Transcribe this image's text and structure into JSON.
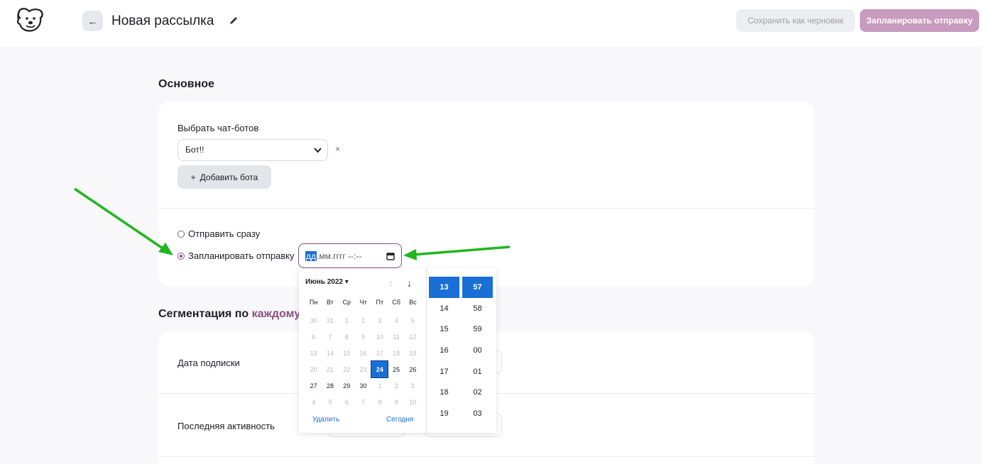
{
  "header": {
    "title": "Новая рассылка",
    "draft_label": "Сохранить как черновик",
    "schedule_label": "Запланировать отправку"
  },
  "basic": {
    "section_title": "Основное",
    "bots_label": "Выбрать чат-ботов",
    "bot_selected": "Бот!!",
    "clear_symbol": "×",
    "add_bot_plus": "+",
    "add_bot_label": "Добавить бота",
    "send_now_label": "Отправить сразу",
    "schedule_label": "Запланировать отправку",
    "datetime_day_placeholder": "дд",
    "datetime_rest_placeholder": ".мм.гггг --:--"
  },
  "segmentation": {
    "title_prefix": "Сегментация по ",
    "title_highlight": "каждому",
    "rows": [
      {
        "label": "Дата подписки"
      },
      {
        "label": "Последняя активность"
      }
    ]
  },
  "picker": {
    "month_label": "Июнь 2022 ▾",
    "up_arrow": "↑",
    "down_arrow": "↓",
    "weekdays": [
      "Пн",
      "Вт",
      "Ср",
      "Чт",
      "Пт",
      "Сб",
      "Вс"
    ],
    "days": [
      [
        "30",
        "31",
        "1",
        "2",
        "3",
        "4",
        "5"
      ],
      [
        "6",
        "7",
        "8",
        "9",
        "10",
        "11",
        "12"
      ],
      [
        "13",
        "14",
        "15",
        "16",
        "17",
        "18",
        "19"
      ],
      [
        "20",
        "21",
        "22",
        "23",
        "24",
        "25",
        "26"
      ],
      [
        "27",
        "28",
        "29",
        "30",
        "1",
        "2",
        "3"
      ],
      [
        "4",
        "5",
        "6",
        "7",
        "8",
        "9",
        "10"
      ]
    ],
    "selected_day": "24",
    "clear_label": "Удалить",
    "today_label": "Сегодня",
    "hours": [
      "13",
      "14",
      "15",
      "16",
      "17",
      "18",
      "19"
    ],
    "minutes": [
      "57",
      "58",
      "59",
      "00",
      "01",
      "02",
      "03"
    ],
    "selected_hour": "13",
    "selected_minute": "57"
  },
  "colors": {
    "accent": "#8a4f86",
    "schedule_button": "#c99bbf",
    "picker_selected": "#1a6fd6",
    "annotation_arrow": "#21b61e"
  }
}
